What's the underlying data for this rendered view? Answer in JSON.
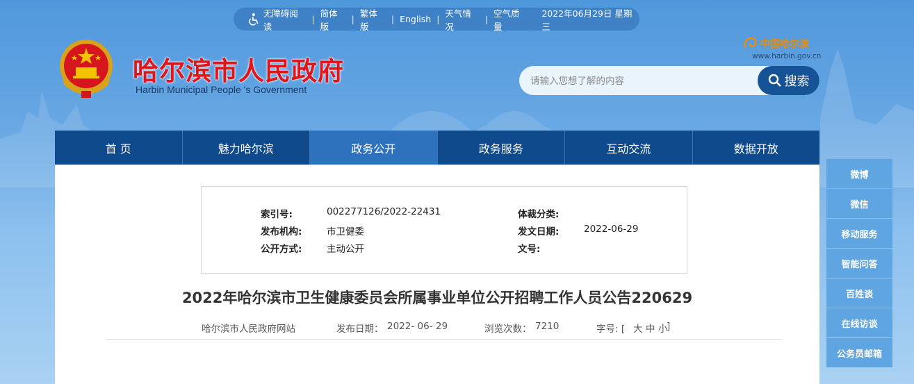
{
  "topbar": {
    "items": [
      "无障碍阅读",
      "简体版",
      "繁体版",
      "English",
      "天气情况",
      "空气质量"
    ],
    "date": "2022年06月29日 星期三"
  },
  "header": {
    "title": "哈尔滨市人民政府",
    "subtitle": "Harbin Municipal People 's Government",
    "brand_logo_text": "中国哈尔滨",
    "brand_url": "www.harbin.gov.cn"
  },
  "search": {
    "placeholder": "请输入您想了解的内容",
    "button_label": "搜索"
  },
  "nav": {
    "items": [
      "首 页",
      "魅力哈尔滨",
      "政务公开",
      "政务服务",
      "互动交流",
      "数据开放"
    ],
    "active": "政务公开"
  },
  "meta": {
    "index_label": "索引号:",
    "index_value": "002277126/2022-22431",
    "category_label": "体裁分类:",
    "category_value": "",
    "publisher_label": "发布机构:",
    "publisher_value": "市卫健委",
    "issue_date_label": "发文日期:",
    "issue_date_value": "2022-06-29",
    "disclosure_label": "公开方式:",
    "disclosure_value": "主动公开",
    "doc_no_label": "文号:",
    "doc_no_value": ""
  },
  "article": {
    "title": "2022年哈尔滨市卫生健康委员会所属事业单位公开招聘工作人员公告220629",
    "source": "哈尔滨市人民政府网站",
    "pub_date_label": "发布日期：",
    "pub_date": "2022- 06- 29",
    "views_label": "浏览次数：",
    "views": "7210",
    "font_label": "字号: [",
    "font_large": "大",
    "font_medium": "中",
    "font_small": "小",
    "font_close": "]"
  },
  "side": {
    "items": [
      "微博",
      "微信",
      "移动服务",
      "智能问答",
      "百姓谈",
      "在线访谈",
      "公务员邮箱"
    ]
  },
  "colors": {
    "nav_bg": "#0f4a8c",
    "nav_active": "#2e72bd",
    "title_red": "#e0141b",
    "side_bg": "#5ea5e2"
  }
}
